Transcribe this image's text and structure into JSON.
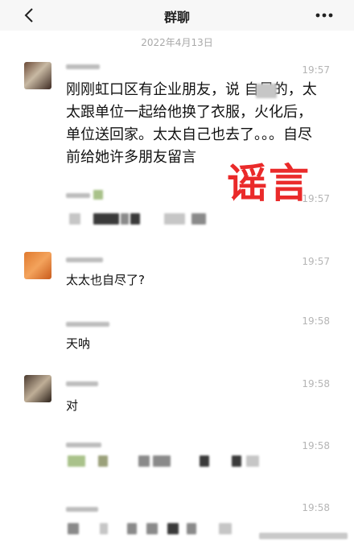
{
  "header": {
    "title": "群聊"
  },
  "date": "2022年4月13日",
  "messages": [
    {
      "time": "19:57",
      "text": "刚刚虹口区有企业朋友，说  自尽的，太太跟单位一起给他换了衣服，火化后，单位送回家。太太自己也去了。。。自尽前给她许多朋友留言"
    },
    {
      "time": "19:57"
    },
    {
      "time": "19:57",
      "text": "太太也自尽了?"
    },
    {
      "time": "19:58",
      "text": "天呐"
    },
    {
      "time": "19:58",
      "text": "对"
    },
    {
      "time": "19:58"
    },
    {
      "time": "19:58"
    }
  ],
  "stamp": "谣言",
  "icons": [
    "back-chevron-icon",
    "more-dots-icon"
  ],
  "colors": {
    "stamp": "#ea2a2a",
    "header_bg": "#f7f7f7"
  }
}
